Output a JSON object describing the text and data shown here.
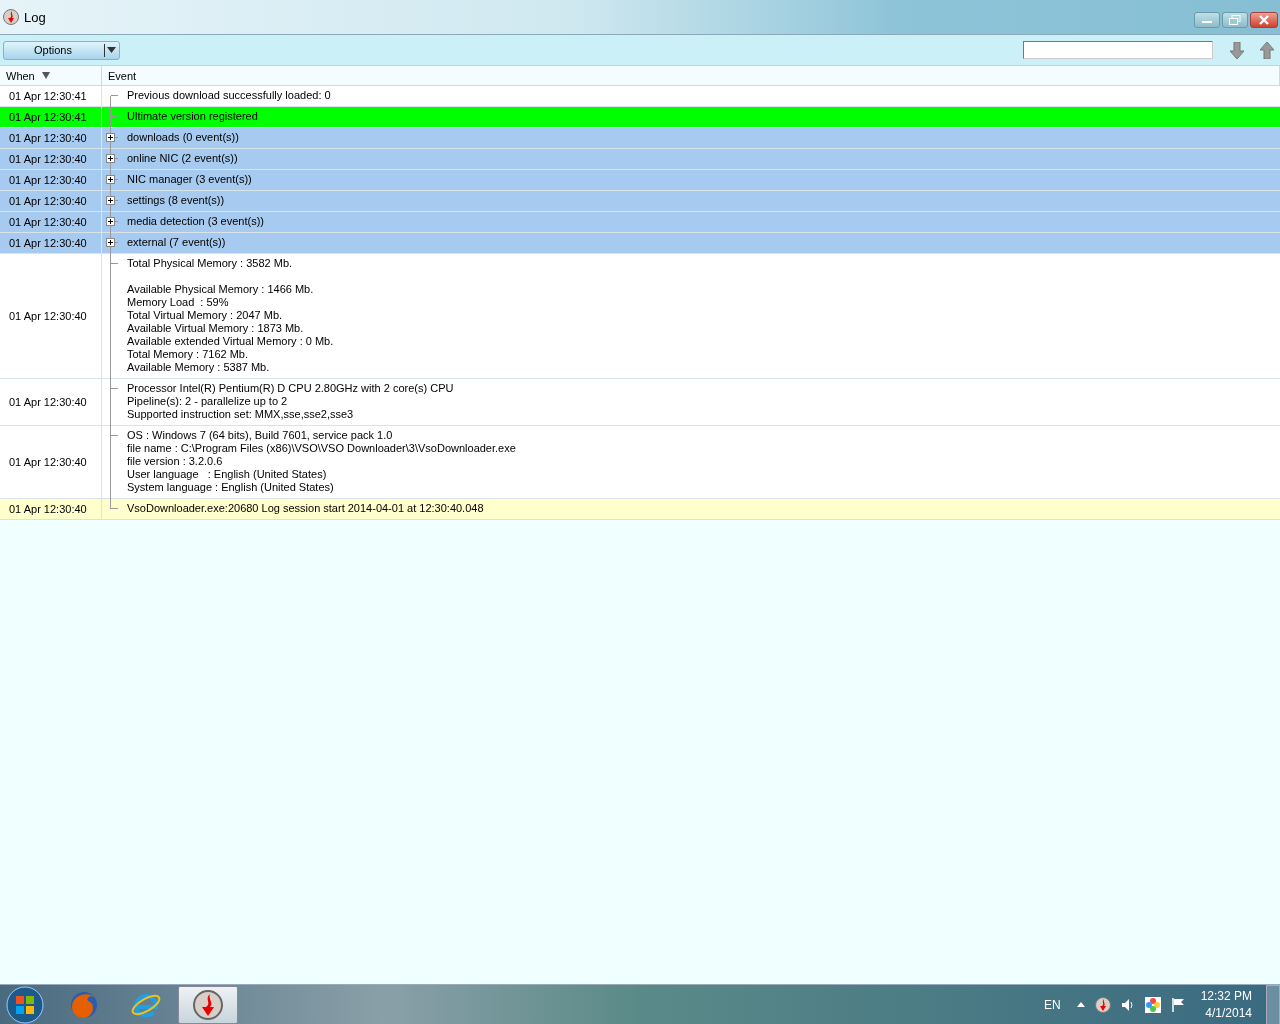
{
  "window": {
    "title": "Log"
  },
  "toolbar": {
    "options_button": "Options"
  },
  "table": {
    "columns": [
      {
        "label": "When",
        "sorted": true
      },
      {
        "label": "Event",
        "sorted": false
      }
    ],
    "rows": [
      {
        "kind": "entry",
        "color": "#ffffff",
        "when": "01 Apr 12:30:41",
        "event": [
          [
            "Previous download successfully loaded: 0"
          ]
        ]
      },
      {
        "kind": "entry",
        "color": "#00ff00",
        "when": "01 Apr 12:30:41",
        "event": [
          [
            "Ultimate version registered"
          ]
        ]
      },
      {
        "kind": "group",
        "color": "#a6caf0",
        "expanded": false,
        "when": "01 Apr 12:30:40",
        "event": [
          [
            "downloads (0 event(s))"
          ]
        ]
      },
      {
        "kind": "group",
        "color": "#a6caf0",
        "expanded": false,
        "when": "01 Apr 12:30:40",
        "event": [
          [
            "online NIC (2 event(s))"
          ]
        ]
      },
      {
        "kind": "group",
        "color": "#a6caf0",
        "expanded": false,
        "when": "01 Apr 12:30:40",
        "event": [
          [
            "NIC manager (3 event(s))"
          ]
        ]
      },
      {
        "kind": "group",
        "color": "#a6caf0",
        "expanded": false,
        "when": "01 Apr 12:30:40",
        "event": [
          [
            "settings (8 event(s))"
          ]
        ]
      },
      {
        "kind": "group",
        "color": "#a6caf0",
        "expanded": false,
        "when": "01 Apr 12:30:40",
        "event": [
          [
            "media detection (3 event(s))"
          ]
        ]
      },
      {
        "kind": "group",
        "color": "#a6caf0",
        "expanded": false,
        "when": "01 Apr 12:30:40",
        "event": [
          [
            "external (7 event(s))"
          ]
        ]
      },
      {
        "kind": "entry",
        "color": "#ffffff",
        "when": "01 Apr 12:30:40",
        "event": [
          [
            "Total Physical Memory : 3582 Mb."
          ],
          [
            "Available Physical Memory : 1466 Mb.",
            "Memory Load  : 59%",
            "Total Virtual Memory : 2047 Mb.",
            "Available Virtual Memory : 1873 Mb.",
            "Available extended Virtual Memory : 0 Mb.",
            "Total Memory : 7162 Mb.",
            "Available Memory : 5387 Mb."
          ]
        ]
      },
      {
        "kind": "entry",
        "color": "#ffffff",
        "when": "01 Apr 12:30:40",
        "event": [
          [
            "Processor Intel(R) Pentium(R) D CPU 2.80GHz with 2 core(s) CPU",
            "Pipeline(s): 2 - parallelize up to 2",
            "Supported instruction set: MMX,sse,sse2,sse3"
          ]
        ]
      },
      {
        "kind": "entry",
        "color": "#ffffff",
        "when": "01 Apr 12:30:40",
        "event": [
          [
            "OS : Windows 7 (64 bits), Build 7601, service pack 1.0",
            "file name : C:\\Program Files (x86)\\VSO\\VSO Downloader\\3\\VsoDownloader.exe",
            "file version : 3.2.0.6",
            "User language   : English (United States)",
            "System language : English (United States)"
          ]
        ]
      },
      {
        "kind": "entry",
        "color": "#ffffcc",
        "when": "01 Apr 12:30:40",
        "event": [
          [
            "VsoDownloader.exe:20680 Log session start 2014-04-01 at 12:30:40.048"
          ]
        ]
      }
    ]
  },
  "taskbar": {
    "apps": [
      {
        "kind": "browser-fox",
        "selected": false
      },
      {
        "kind": "browser-e",
        "selected": false
      },
      {
        "kind": "downloader",
        "selected": true
      }
    ],
    "tray": {
      "language": "EN",
      "time": "12:32 PM",
      "date": "4/1/2014"
    }
  }
}
